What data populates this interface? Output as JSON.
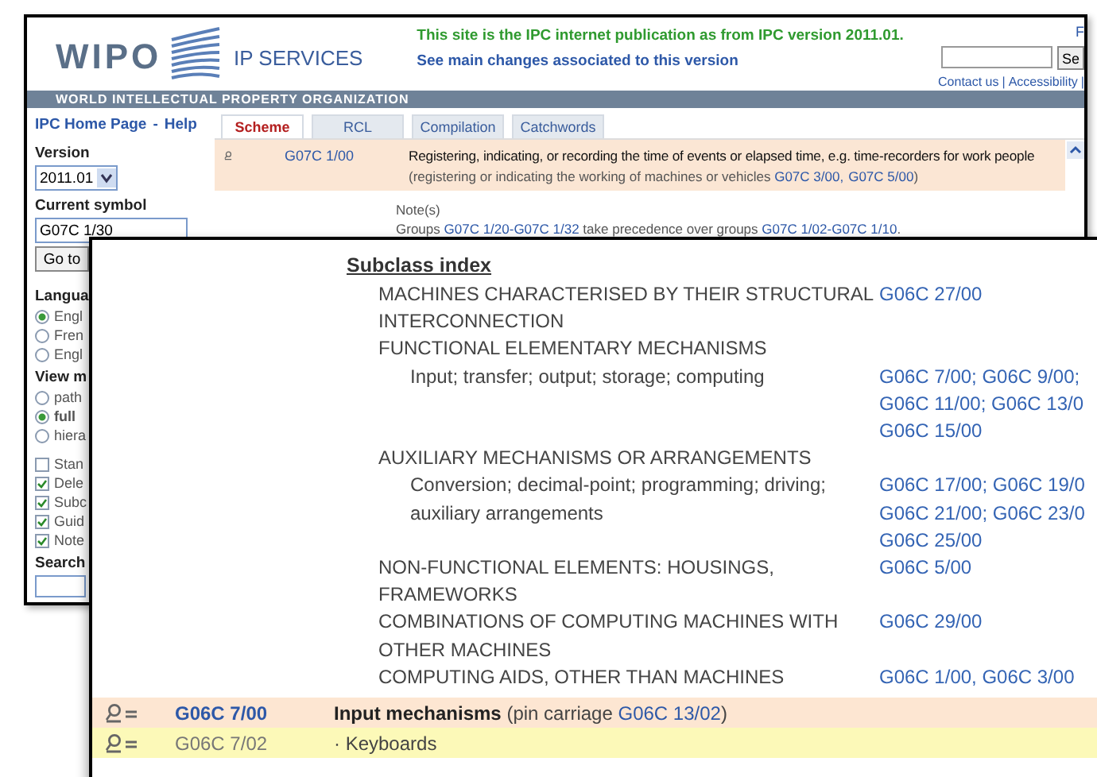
{
  "back_window": {
    "logo": "WIPO",
    "service": "IP SERVICES",
    "notice": "This site is the IPC internet publication as from IPC version 2011.01.",
    "changes_link": "See main changes associated to this version",
    "corner_letter": "F",
    "search_button": "Se",
    "top_links": [
      "Contact us",
      "|",
      "Accessibility",
      "|"
    ],
    "band": "WORLD INTELLECTUAL PROPERTY ORGANIZATION",
    "sidebar": {
      "home_links": [
        "IPC Home Page",
        "-",
        "Help"
      ],
      "version_label": "Version",
      "version": "2011.01",
      "symbol_label": "Current symbol",
      "symbol": "G07C 1/30",
      "go_button": "Go to",
      "language_label": "Langua",
      "languages": [
        {
          "label": "Engl",
          "selected": true
        },
        {
          "label": "Fren",
          "selected": false
        },
        {
          "label": "Engl",
          "selected": false
        }
      ],
      "view_label": "View m",
      "views": [
        {
          "label": "path",
          "selected": false
        },
        {
          "label": "full",
          "selected": true
        },
        {
          "label": "hiera",
          "selected": false
        }
      ],
      "options": [
        {
          "label": "Stan",
          "checked": false
        },
        {
          "label": "Dele",
          "checked": true
        },
        {
          "label": "Subc",
          "checked": true
        },
        {
          "label": "Guid",
          "checked": true
        },
        {
          "label": "Note",
          "checked": true
        }
      ],
      "search_label": "Search"
    },
    "tabs": [
      {
        "label": "Scheme",
        "selected": true
      },
      {
        "label": "RCL",
        "selected": false
      },
      {
        "label": "Compilation",
        "selected": false
      },
      {
        "label": "Catchwords",
        "selected": false
      }
    ],
    "entry": {
      "symbol": "G07C 1/00",
      "title": "Registering, indicating, or recording the time of events or elapsed time, e.g. time-recorders for work people",
      "reference": [
        {
          "kind": "text",
          "text": "(registering or indicating the working of machines or vehicles "
        },
        {
          "kind": "link",
          "text": "G07C 3/00,"
        },
        {
          "kind": "link",
          "text": "G07C 5/00"
        },
        {
          "kind": "text",
          "text": ")"
        }
      ]
    },
    "note_label": "Note(s)",
    "note": [
      {
        "kind": "text",
        "text": "Groups "
      },
      {
        "kind": "link",
        "text": "G07C 1/20-G07C 1/32"
      },
      {
        "kind": "text",
        "text": " take precedence over groups "
      },
      {
        "kind": "link",
        "text": "G07C 1/02-G07C 1/10"
      },
      {
        "kind": "text",
        "text": "."
      }
    ]
  },
  "front_window": {
    "index_title": "Subclass index",
    "entries": [
      {
        "term": "MACHINES CHARACTERISED BY THEIR STRUCTURAL INTERCONNECTION",
        "codes": [
          "G06C 27/00"
        ]
      },
      {
        "term": "FUNCTIONAL ELEMENTARY MECHANISMS",
        "children": [
          {
            "term": "Input; transfer; output; storage; computing",
            "codes": [
              "G06C 7/00; G06C 9/00;",
              "G06C 11/00; G06C 13/0",
              "G06C 15/00"
            ]
          }
        ]
      },
      {
        "term": "AUXILIARY MECHANISMS OR ARRANGEMENTS",
        "children": [
          {
            "term": "Conversion; decimal-point; programming; driving; auxiliary arrangements",
            "codes": [
              "G06C 17/00; G06C 19/0",
              "G06C 21/00; G06C 23/0",
              "G06C 25/00"
            ]
          }
        ]
      },
      {
        "term": "NON-FUNCTIONAL ELEMENTS: HOUSINGS, FRAMEWORKS",
        "codes": [
          "G06C 5/00"
        ]
      },
      {
        "term": "COMBINATIONS OF COMPUTING MACHINES WITH OTHER MACHINES",
        "codes": [
          "G06C 29/00"
        ]
      },
      {
        "term": "COMPUTING AIDS, OTHER THAN MACHINES",
        "codes": [
          "G06C 1/00, G06C 3/00"
        ]
      }
    ],
    "rows": [
      {
        "kind": "group",
        "symbol": "G06C 7/00",
        "title": [
          {
            "kind": "bold",
            "text": "Input mechanisms"
          },
          {
            "kind": "text",
            "text": " (pin carriage "
          },
          {
            "kind": "link",
            "text": "G06C 13/02"
          },
          {
            "kind": "text",
            "text": ")"
          }
        ]
      },
      {
        "kind": "subgroup",
        "symbol": "G06C 7/02",
        "title": [
          {
            "kind": "text",
            "text": "· Keyboards"
          }
        ]
      }
    ]
  }
}
